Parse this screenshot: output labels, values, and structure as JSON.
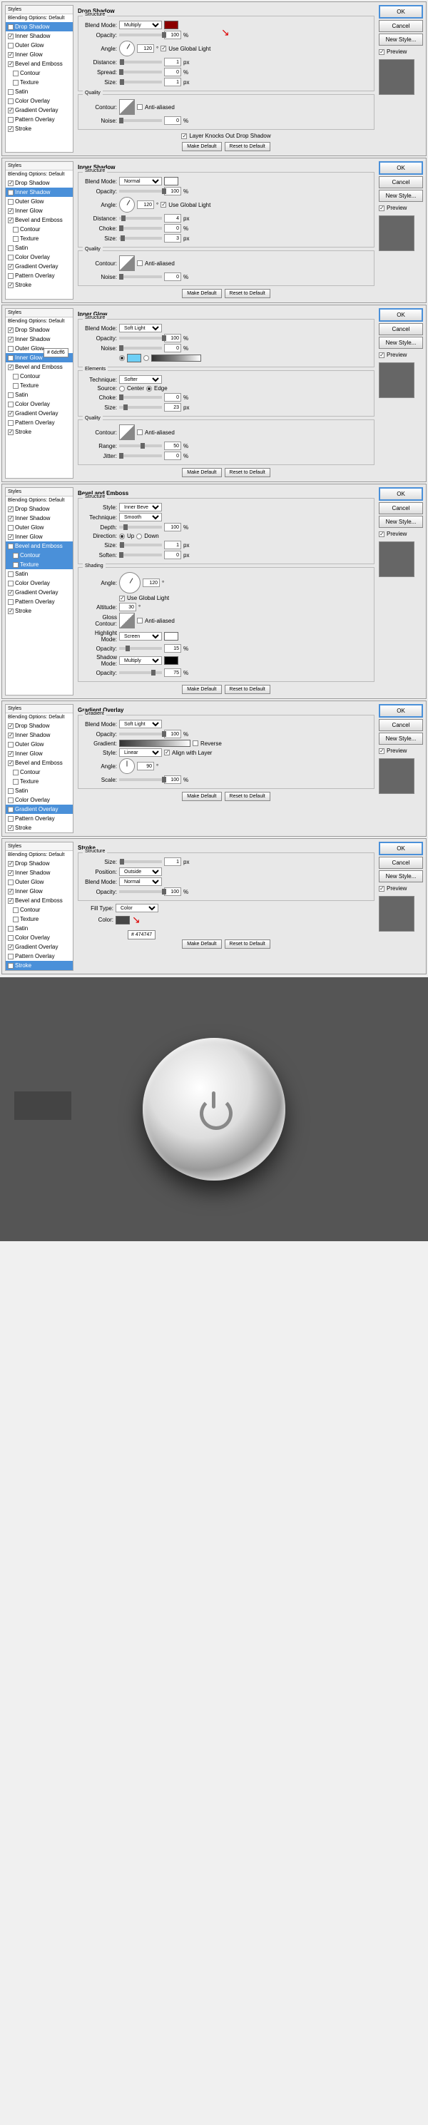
{
  "common": {
    "styles_header": "Styles",
    "blending_default": "Blending Options: Default",
    "ok": "OK",
    "cancel": "Cancel",
    "new_style": "New Style...",
    "preview": "Preview",
    "make_default": "Make Default",
    "reset_default": "Reset to Default",
    "blend_mode": "Blend Mode:",
    "opacity": "Opacity:",
    "angle": "Angle:",
    "distance": "Distance:",
    "size": "Size:",
    "contour": "Contour:",
    "noise": "Noise:",
    "anti_aliased": "Anti-aliased",
    "structure": "Structure",
    "quality": "Quality",
    "use_global": "Use Global Light",
    "pct": "%",
    "px": "px",
    "deg": "°"
  },
  "styles_list": [
    "Drop Shadow",
    "Inner Shadow",
    "Outer Glow",
    "Inner Glow",
    "Bevel and Emboss",
    "Contour",
    "Texture",
    "Satin",
    "Color Overlay",
    "Gradient Overlay",
    "Pattern Overlay",
    "Stroke"
  ],
  "d1": {
    "title": "Drop Shadow",
    "mode": "Multiply",
    "opacity": "100",
    "angle": "120",
    "distance": "1",
    "spread": "0",
    "size": "1",
    "noise": "0",
    "spread_lbl": "Spread:",
    "knockout": "Layer Knocks Out Drop Shadow",
    "selected": 0,
    "checked": [
      0,
      1,
      3,
      4,
      9,
      11
    ]
  },
  "d2": {
    "title": "Inner Shadow",
    "mode": "Normal",
    "opacity": "100",
    "angle": "120",
    "distance": "4",
    "choke": "0",
    "size": "3",
    "noise": "0",
    "choke_lbl": "Choke:",
    "selected": 1,
    "checked": [
      0,
      1,
      3,
      4,
      9,
      11
    ]
  },
  "d3": {
    "title": "Inner Glow",
    "mode": "Soft Light",
    "opacity": "100",
    "noise": "0",
    "elements": "Elements",
    "technique": "Technique:",
    "technique_v": "Softer",
    "source": "Source:",
    "center": "Center",
    "edge": "Edge",
    "choke": "Choke:",
    "choke_v": "0",
    "size_v": "23",
    "range": "Range:",
    "range_v": "50",
    "jitter": "Jitter:",
    "jitter_v": "0",
    "hex": "6dcff6",
    "selected": 3,
    "checked": [
      0,
      1,
      3,
      4,
      9,
      11
    ]
  },
  "d4": {
    "title": "Bevel and Emboss",
    "style_lbl": "Style:",
    "style_v": "Inner Bevel",
    "technique": "Technique:",
    "technique_v": "Smooth",
    "depth": "Depth:",
    "depth_v": "100",
    "direction": "Direction:",
    "up": "Up",
    "down": "Down",
    "size_v": "1",
    "soften": "Soften:",
    "soften_v": "0",
    "shading": "Shading",
    "angle_v": "120",
    "altitude": "Altitude:",
    "altitude_v": "30",
    "gloss": "Gloss Contour:",
    "highlight": "Highlight Mode:",
    "highlight_v": "Screen",
    "h_opacity": "15",
    "shadow": "Shadow Mode:",
    "shadow_v": "Multiply",
    "s_opacity": "75",
    "selected": 4,
    "checked": [
      0,
      1,
      3,
      4,
      5,
      6,
      9,
      11
    ]
  },
  "d5": {
    "title": "Gradient Overlay",
    "gradient": "Gradient",
    "mode": "Soft Light",
    "opacity": "100",
    "grad_lbl": "Gradient:",
    "reverse": "Reverse",
    "style_lbl": "Style:",
    "style_v": "Linear",
    "align": "Align with Layer",
    "angle_v": "90",
    "scale": "Scale:",
    "scale_v": "100",
    "selected": 9,
    "checked": [
      0,
      1,
      3,
      4,
      9,
      11
    ]
  },
  "d6": {
    "title": "Stroke",
    "size_v": "1",
    "position": "Position:",
    "position_v": "Outside",
    "mode": "Normal",
    "opacity": "100",
    "fill_type": "Fill Type:",
    "fill_v": "Color",
    "color_lbl": "Color:",
    "hex": "474747",
    "selected": 11,
    "checked": [
      0,
      1,
      3,
      4,
      9,
      11
    ]
  }
}
